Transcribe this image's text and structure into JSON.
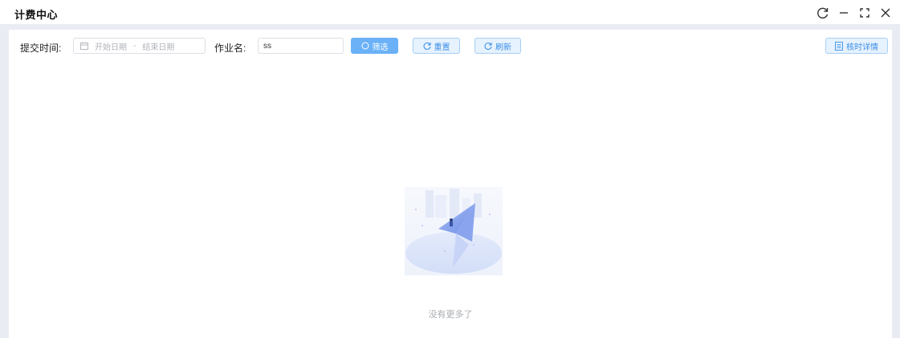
{
  "window": {
    "title": "计费中心"
  },
  "toolbar": {
    "submit_time_label": "提交时间:",
    "start_date_placeholder": "开始日期",
    "date_separator": "-",
    "end_date_placeholder": "结束日期",
    "job_name_label": "作业名:",
    "job_name_value": "ss",
    "filter_label": "筛选",
    "reset_label": "重置",
    "refresh_label": "刷新",
    "hours_detail_label": "核时详情"
  },
  "empty": {
    "message": "没有更多了"
  },
  "colors": {
    "primary": "#6ab1f7",
    "light_button_bg": "#e6f2fe",
    "light_button_text": "#3a8ee6",
    "frame_bg": "#e9ecf2"
  },
  "icons": [
    "refresh-icon",
    "minimize-icon",
    "maximize-icon",
    "close-icon",
    "calendar-icon",
    "search-icon",
    "reset-icon",
    "document-icon",
    "paper-plane-illustration"
  ]
}
